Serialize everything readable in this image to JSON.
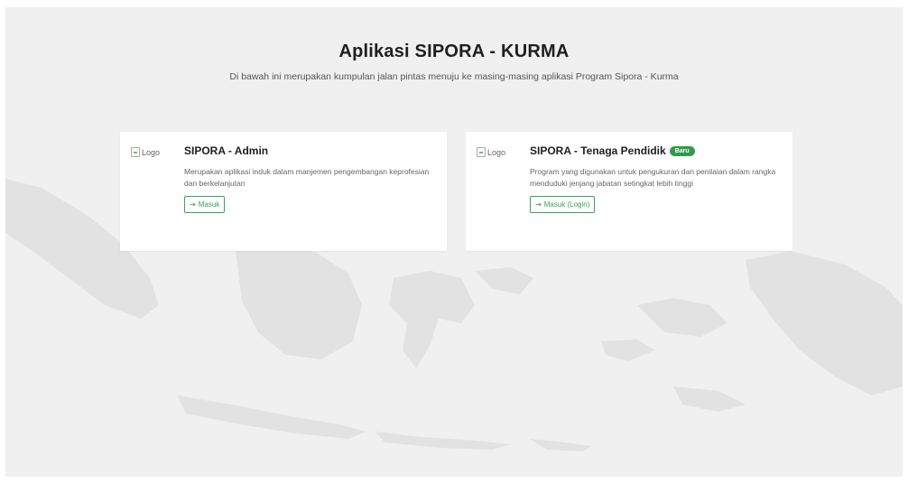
{
  "header": {
    "title": "Aplikasi SIPORA - KURMA",
    "subtitle": "Di bawah ini merupakan kumpulan jalan pintas menuju ke masing-masing aplikasi Program Sipora - Kurma"
  },
  "cards": [
    {
      "logo_alt": "Logo",
      "title": "SIPORA - Admin",
      "badge": "",
      "description": "Merupakan aplikasi induk dalam manjemen pengembangan keprofesian dan berkelanjutan",
      "button_label": "Masuk",
      "button_icon": "enter-icon"
    },
    {
      "logo_alt": "Logo",
      "title": "SIPORA - Tenaga Pendidik",
      "badge": "Baru",
      "description": "Program yang digunakan untuk pengukuran dan penilaian dalam rangka menduduki jenjang jabatan setingkat lebih tinggi",
      "button_label": "Masuk (Login)",
      "button_icon": "enter-icon"
    }
  ],
  "colors": {
    "accent": "#3aa35a",
    "badge": "#2e9b4e",
    "background": "#f0f0f0",
    "map": "#e3e3e3"
  }
}
